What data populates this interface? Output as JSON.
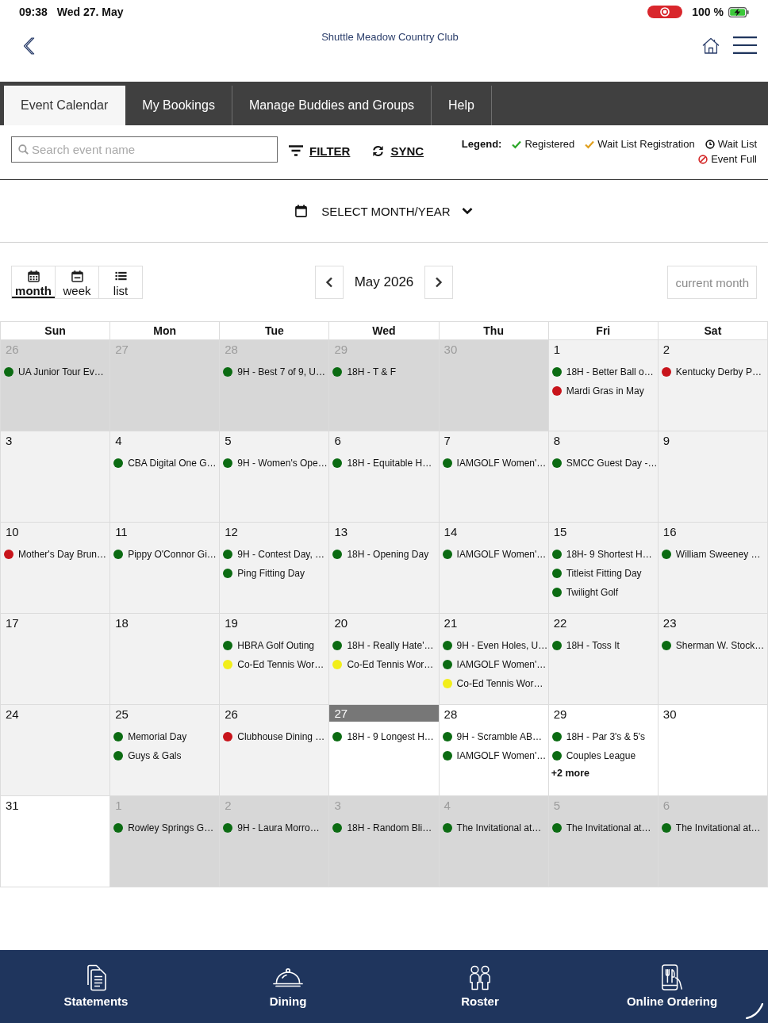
{
  "status_bar": {
    "time": "09:38",
    "date": "Wed 27. May",
    "battery": "100 %"
  },
  "header": {
    "title": "Shuttle Meadow Country Club"
  },
  "tabs": [
    {
      "label": "Event Calendar",
      "selected": true
    },
    {
      "label": "My Bookings",
      "selected": false
    },
    {
      "label": "Manage Buddies and Groups",
      "selected": false
    },
    {
      "label": "Help",
      "selected": false
    }
  ],
  "toolbar": {
    "search": {
      "placeholder": "Search event name"
    },
    "filter": "FILTER",
    "sync": "SYNC"
  },
  "legend": {
    "title": "Legend:",
    "items": [
      {
        "kind": "check",
        "color": "#2ea82b",
        "label": "Registered"
      },
      {
        "kind": "check",
        "color": "#e0a020",
        "label": "Wait List Registration"
      },
      {
        "kind": "clock",
        "color": "#111111",
        "label": "Wait List"
      },
      {
        "kind": "ban",
        "color": "#d42a2a",
        "label": "Event Full"
      }
    ]
  },
  "month_picker": {
    "label": "SELECT MONTH/YEAR"
  },
  "views": [
    {
      "kind": "month",
      "label": "month",
      "selected": true
    },
    {
      "kind": "week",
      "label": "week",
      "selected": false
    },
    {
      "kind": "list",
      "label": "list",
      "selected": false
    }
  ],
  "navigator": {
    "label": "May 2026"
  },
  "current_month": "current month",
  "calendar": {
    "weekdays": [
      "Sun",
      "Mon",
      "Tue",
      "Wed",
      "Thu",
      "Fri",
      "Sat"
    ],
    "weeks": [
      {
        "days": [
          {
            "day": "26",
            "kind": "outside",
            "events": [
              {
                "title": "UA Junior Tour Ev…",
                "color": "#0b6b12"
              }
            ]
          },
          {
            "day": "27",
            "kind": "outside"
          },
          {
            "day": "28",
            "kind": "outside",
            "events": [
              {
                "title": "9H - Best 7 of 9, U…",
                "color": "#0b6b12"
              }
            ]
          },
          {
            "day": "29",
            "kind": "outside",
            "events": [
              {
                "title": "18H - T & F",
                "color": "#0b6b12"
              }
            ]
          },
          {
            "day": "30",
            "kind": "outside"
          },
          {
            "day": "1",
            "kind": "past",
            "events": [
              {
                "title": "18H - Better Ball o…",
                "color": "#0b6b12"
              },
              {
                "title": "Mardi Gras in May",
                "color": "#c8141b"
              }
            ]
          },
          {
            "day": "2",
            "kind": "past",
            "events": [
              {
                "title": "Kentucky Derby P…",
                "color": "#c8141b"
              }
            ]
          }
        ]
      },
      {
        "days": [
          {
            "day": "3",
            "kind": "past"
          },
          {
            "day": "4",
            "kind": "past",
            "events": [
              {
                "title": "CBA Digital One G…",
                "color": "#0b6b12"
              }
            ]
          },
          {
            "day": "5",
            "kind": "past",
            "events": [
              {
                "title": "9H - Women's Ope…",
                "color": "#0b6b12"
              }
            ]
          },
          {
            "day": "6",
            "kind": "past",
            "events": [
              {
                "title": "18H - Equitable H…",
                "color": "#0b6b12"
              }
            ]
          },
          {
            "day": "7",
            "kind": "past",
            "events": [
              {
                "title": "IAMGOLF Women'…",
                "color": "#0b6b12"
              }
            ]
          },
          {
            "day": "8",
            "kind": "past",
            "events": [
              {
                "title": "SMCC Guest Day -…",
                "color": "#0b6b12"
              }
            ]
          },
          {
            "day": "9",
            "kind": "past"
          }
        ]
      },
      {
        "days": [
          {
            "day": "10",
            "kind": "past",
            "events": [
              {
                "title": "Mother's Day Brun…",
                "color": "#c8141b"
              }
            ]
          },
          {
            "day": "11",
            "kind": "past",
            "events": [
              {
                "title": "Pippy O'Connor Gi…",
                "color": "#0b6b12"
              }
            ]
          },
          {
            "day": "12",
            "kind": "past",
            "events": [
              {
                "title": "9H - Contest Day, …",
                "color": "#0b6b12"
              },
              {
                "title": "Ping Fitting Day",
                "color": "#0b6b12"
              }
            ]
          },
          {
            "day": "13",
            "kind": "past",
            "events": [
              {
                "title": "18H - Opening Day",
                "color": "#0b6b12"
              }
            ]
          },
          {
            "day": "14",
            "kind": "past",
            "events": [
              {
                "title": "IAMGOLF Women'…",
                "color": "#0b6b12"
              }
            ]
          },
          {
            "day": "15",
            "kind": "past",
            "events": [
              {
                "title": "18H- 9 Shortest H…",
                "color": "#0b6b12"
              },
              {
                "title": "Titleist Fitting Day",
                "color": "#0b6b12"
              },
              {
                "title": "Twilight Golf",
                "color": "#0b6b12"
              }
            ]
          },
          {
            "day": "16",
            "kind": "past",
            "events": [
              {
                "title": "William Sweeney …",
                "color": "#0b6b12"
              }
            ]
          }
        ]
      },
      {
        "days": [
          {
            "day": "17",
            "kind": "past"
          },
          {
            "day": "18",
            "kind": "past"
          },
          {
            "day": "19",
            "kind": "past",
            "events": [
              {
                "title": "HBRA Golf Outing",
                "color": "#0b6b12"
              },
              {
                "title": "Co-Ed Tennis Wor…",
                "color": "#f2ee1a"
              }
            ]
          },
          {
            "day": "20",
            "kind": "past",
            "events": [
              {
                "title": "18H - Really Hate'…",
                "color": "#0b6b12"
              },
              {
                "title": "Co-Ed Tennis Wor…",
                "color": "#f2ee1a"
              }
            ]
          },
          {
            "day": "21",
            "kind": "past",
            "events": [
              {
                "title": "9H - Even Holes, U…",
                "color": "#0b6b12"
              },
              {
                "title": "IAMGOLF Women'…",
                "color": "#0b6b12"
              },
              {
                "title": "Co-Ed Tennis Wor…",
                "color": "#f2ee1a"
              }
            ]
          },
          {
            "day": "22",
            "kind": "past",
            "events": [
              {
                "title": "18H - Toss It",
                "color": "#0b6b12"
              }
            ]
          },
          {
            "day": "23",
            "kind": "past",
            "events": [
              {
                "title": "Sherman W. Stock…",
                "color": "#0b6b12"
              }
            ]
          }
        ]
      },
      {
        "days": [
          {
            "day": "24",
            "kind": "past"
          },
          {
            "day": "25",
            "kind": "past",
            "events": [
              {
                "title": "Memorial Day",
                "color": "#0b6b12"
              },
              {
                "title": "Guys & Gals",
                "color": "#0b6b12"
              }
            ]
          },
          {
            "day": "26",
            "kind": "past",
            "events": [
              {
                "title": "Clubhouse Dining …",
                "color": "#c8141b"
              }
            ]
          },
          {
            "day": "27",
            "kind": "today",
            "events": [
              {
                "title": "18H - 9 Longest H…",
                "color": "#0b6b12"
              }
            ]
          },
          {
            "day": "28",
            "kind": "future",
            "events": [
              {
                "title": "9H - Scramble AB…",
                "color": "#0b6b12"
              },
              {
                "title": "IAMGOLF Women'…",
                "color": "#0b6b12"
              }
            ]
          },
          {
            "day": "29",
            "kind": "future",
            "events": [
              {
                "title": "18H - Par 3's & 5's",
                "color": "#0b6b12"
              },
              {
                "title": "Couples League",
                "color": "#0b6b12"
              }
            ],
            "more": "+2 more"
          },
          {
            "day": "30",
            "kind": "future"
          }
        ]
      },
      {
        "days": [
          {
            "day": "31",
            "kind": "future"
          },
          {
            "day": "1",
            "kind": "outside",
            "events": [
              {
                "title": "Rowley Springs G…",
                "color": "#0b6b12"
              }
            ]
          },
          {
            "day": "2",
            "kind": "outside",
            "events": [
              {
                "title": "9H - Laura Morro…",
                "color": "#0b6b12"
              }
            ]
          },
          {
            "day": "3",
            "kind": "outside",
            "events": [
              {
                "title": "18H - Random Bli…",
                "color": "#0b6b12"
              }
            ]
          },
          {
            "day": "4",
            "kind": "outside",
            "events": [
              {
                "title": "The Invitational at…",
                "color": "#0b6b12"
              }
            ]
          },
          {
            "day": "5",
            "kind": "outside",
            "events": [
              {
                "title": "The Invitational at…",
                "color": "#0b6b12"
              }
            ]
          },
          {
            "day": "6",
            "kind": "outside",
            "events": [
              {
                "title": "The Invitational at…",
                "color": "#0b6b12"
              }
            ]
          }
        ]
      }
    ]
  },
  "bottom_nav": [
    {
      "kind": "statements",
      "label": "Statements"
    },
    {
      "kind": "dining",
      "label": "Dining"
    },
    {
      "kind": "roster",
      "label": "Roster"
    },
    {
      "kind": "online_ordering",
      "label": "Online Ordering"
    }
  ]
}
